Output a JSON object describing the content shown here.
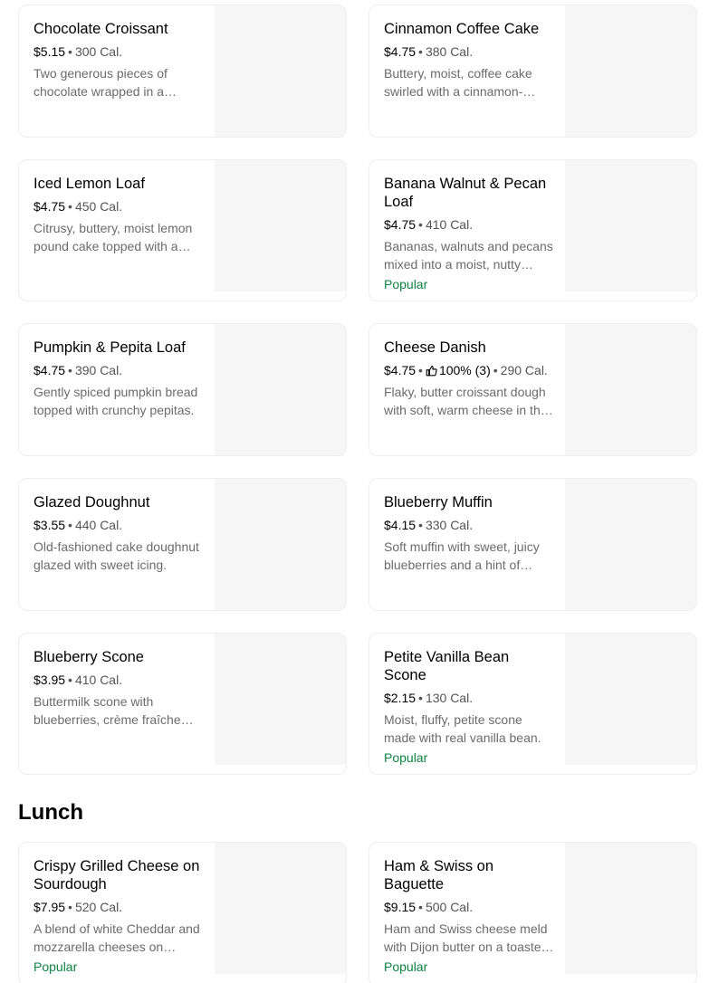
{
  "items": [
    {
      "name": "Chocolate Croissant",
      "price": "$5.15",
      "calories": "300 Cal.",
      "description": "Two generous pieces of chocolate wrapped in a buttery, flaky croissant.",
      "badge": ""
    },
    {
      "name": "Cinnamon Coffee Cake",
      "price": "$4.75",
      "calories": "380 Cal.",
      "description": "Buttery, moist, coffee cake swirled with a cinnamon-sugar filling.",
      "badge": ""
    },
    {
      "name": "Iced Lemon Loaf",
      "price": "$4.75",
      "calories": "450 Cal.",
      "description": "Citrusy, buttery, moist lemon pound cake topped with a sweet icing.",
      "badge": ""
    },
    {
      "name": "Banana Walnut & Pecan Loaf",
      "price": "$4.75",
      "calories": "410 Cal.",
      "description": "Bananas, walnuts and pecans mixed into a moist, nutty bread.",
      "badge": "Popular"
    },
    {
      "name": "Pumpkin & Pepita Loaf",
      "price": "$4.75",
      "calories": "390 Cal.",
      "description": "Gently spiced pumpkin bread topped with crunchy pepitas.",
      "badge": ""
    },
    {
      "name": "Cheese Danish",
      "price": "$4.75",
      "rating": "100% (3)",
      "calories": "290 Cal.",
      "description": "Flaky, butter croissant dough with soft, warm cheese in the center.",
      "badge": ""
    },
    {
      "name": "Glazed Doughnut",
      "price": "$3.55",
      "calories": "440 Cal.",
      "description": "Old-fashioned cake doughnut glazed with sweet icing.",
      "badge": ""
    },
    {
      "name": "Blueberry Muffin",
      "price": "$4.15",
      "calories": "330 Cal.",
      "description": "Soft muffin with sweet, juicy blueberries and a hint of lemon.",
      "badge": ""
    },
    {
      "name": "Blueberry Scone",
      "price": "$3.95",
      "calories": "410 Cal.",
      "description": "Buttermilk scone with blueberries, crème fraîche and lemon.",
      "badge": ""
    },
    {
      "name": "Petite Vanilla Bean Scone",
      "price": "$2.15",
      "calories": "130 Cal.",
      "description": "Moist, fluffy, petite scone made with real vanilla bean.",
      "badge": "Popular"
    }
  ],
  "lunch": {
    "title": "Lunch",
    "items": [
      {
        "name": "Crispy Grilled Cheese on Sourdough",
        "price": "$7.95",
        "calories": "520 Cal.",
        "description": "A blend of white Cheddar and mozzarella cheeses on sourdough bread.",
        "badge": "Popular"
      },
      {
        "name": "Ham & Swiss on Baguette",
        "price": "$9.15",
        "calories": "500 Cal.",
        "description": "Ham and Swiss cheese meld with Dijon butter on a toasted baguette.",
        "badge": "Popular"
      }
    ]
  },
  "icons": {
    "rating": "thumbs-up-icon"
  },
  "colors": {
    "popular": "#0e8345",
    "image_placeholder": "#f6f6f6"
  }
}
